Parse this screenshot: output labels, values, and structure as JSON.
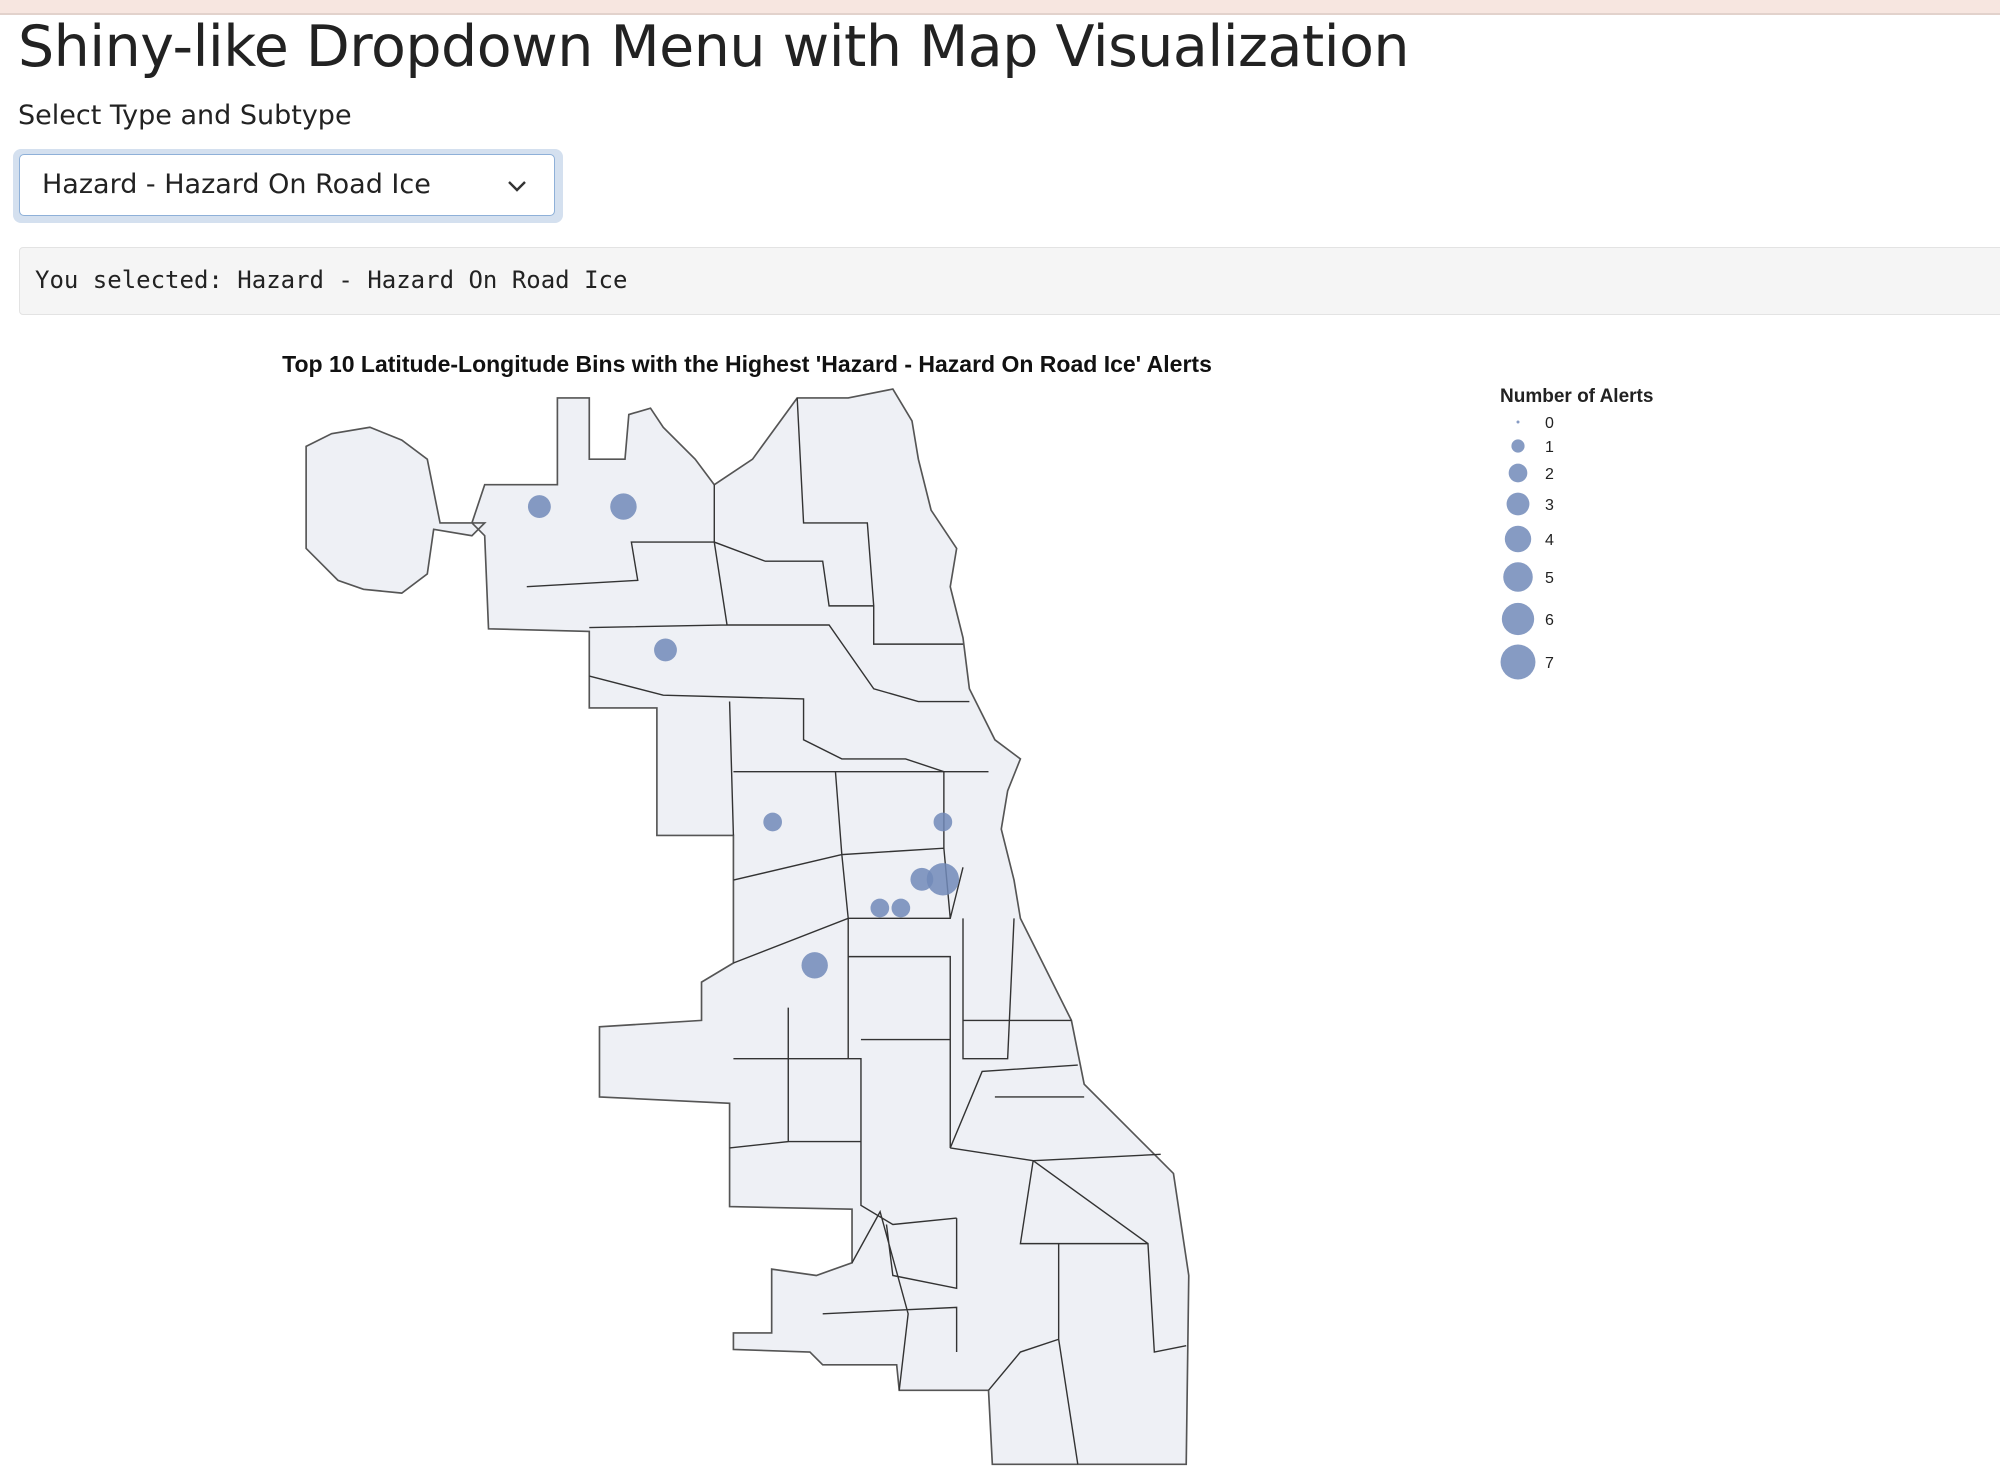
{
  "page": {
    "title": "Shiny-like Dropdown Menu with Map Visualization",
    "select_label": "Select Type and Subtype",
    "selected_value": "Hazard - Hazard On Road Ice",
    "output_text": "You selected: Hazard - Hazard On Road Ice"
  },
  "chart_data": {
    "type": "scatter",
    "title": "Top 10 Latitude-Longitude Bins with the Highest 'Hazard - Hazard On Road Ice' Alerts",
    "legend_title": "Number of Alerts",
    "legend_values": [
      "0",
      "1",
      "2",
      "3",
      "4",
      "5",
      "6",
      "7"
    ],
    "legend_placement": "top-right",
    "point_color": "#7189b8",
    "region_fill": "#eef0f5",
    "region_stroke": "#3a3a3a",
    "xlim": [
      -87.94,
      -87.52
    ],
    "ylim": [
      41.645,
      42.02
    ],
    "points": [
      {
        "lon": -87.829,
        "lat": 41.979,
        "alerts": 3
      },
      {
        "lon": -87.789,
        "lat": 41.979,
        "alerts": 4
      },
      {
        "lon": -87.769,
        "lat": 41.929,
        "alerts": 3
      },
      {
        "lon": -87.718,
        "lat": 41.869,
        "alerts": 2
      },
      {
        "lon": -87.637,
        "lat": 41.869,
        "alerts": 2
      },
      {
        "lon": -87.647,
        "lat": 41.849,
        "alerts": 3
      },
      {
        "lon": -87.637,
        "lat": 41.849,
        "alerts": 6
      },
      {
        "lon": -87.667,
        "lat": 41.839,
        "alerts": 2
      },
      {
        "lon": -87.657,
        "lat": 41.839,
        "alerts": 2
      },
      {
        "lon": -87.698,
        "lat": 41.819,
        "alerts": 4
      }
    ]
  }
}
